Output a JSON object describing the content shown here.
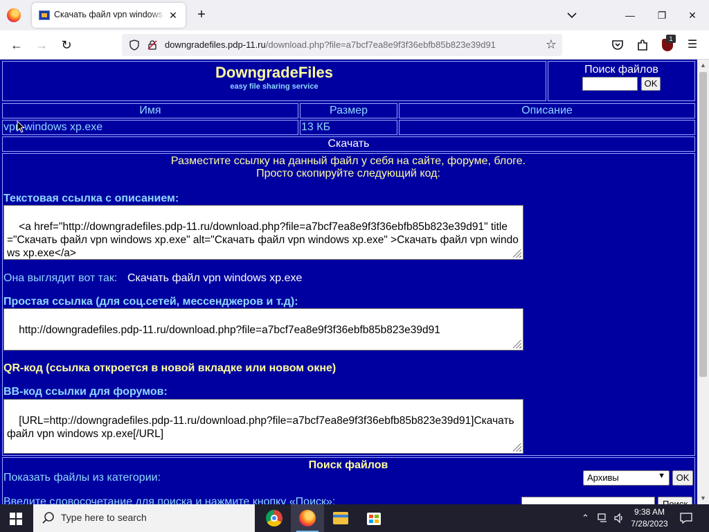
{
  "browser": {
    "tab_title": "Скачать файл vpn windows xp.exe",
    "url_host": "downgradefiles.pdp-11.ru",
    "url_path": "/download.php?file=a7bcf7ea8e9f3f36ebfb85b823e39d91",
    "extension_badge": "1",
    "icons": [
      "firefox-icon",
      "close-icon",
      "plus-icon",
      "chevron-down-icon",
      "back-icon",
      "forward-icon",
      "reload-icon",
      "shield-icon",
      "lock-icon",
      "star-icon",
      "pocket-icon",
      "extensions-icon",
      "ublock-icon",
      "menu-icon"
    ]
  },
  "page": {
    "site_title": "DowngradeFiles",
    "site_subtitle": "easy file sharing service",
    "search_title": "Поиск файлов",
    "search_ok": "OK",
    "table": {
      "headers": [
        "Имя",
        "Размер",
        "Описание"
      ],
      "row": {
        "name": "vpn windows xp.exe",
        "size": "13 КБ",
        "description": ""
      }
    },
    "download_label": "Скачать",
    "share_line1": "Разместите ссылку на данный файл у себя на сайте, форуме, блоге.",
    "share_line2": "Просто скопируйте следующий код:",
    "text_link_label": "Текстовая ссылка с описанием:",
    "text_link_code": "<a href=\"http://downgradefiles.pdp-11.ru/download.php?file=a7bcf7ea8e9f3f36ebfb85b823e39d91\" title=\"Скачать файл vpn windows xp.exe\" alt=\"Скачать файл vpn windows xp.exe\" >Скачать файл vpn windows xp.exe</a>",
    "preview_label": "Она выглядит вот так:",
    "preview_link": "Скачать файл vpn windows xp.exe",
    "simple_link_label": "Простая ссылка (для соц.сетей, мессенджеров и т.д):",
    "simple_link_code": "http://downgradefiles.pdp-11.ru/download.php?file=a7bcf7ea8e9f3f36ebfb85b823e39d91",
    "qr_label": "QR-код (ссылка откроется в новой вкладке или новом окне)",
    "bb_label": "BB-код ссылки для форумов:",
    "bb_code": "[URL=http://downgradefiles.pdp-11.ru/download.php?file=a7bcf7ea8e9f3f36ebfb85b823e39d91]Скачать файл vpn windows xp.exe[/URL]",
    "file_search_title": "Поиск файлов",
    "category_label": "Показать файлы из категории:",
    "category_selected": "Архивы",
    "category_ok": "OK",
    "keyword_label": "Введите словосочетание для поиска и нажмите кнопку «Поиск»:",
    "search_button": "Поиск"
  },
  "taskbar": {
    "search_placeholder": "Type here to search",
    "time": "9:38 AM",
    "date": "7/28/2023",
    "apps": [
      "chrome-icon",
      "firefox-icon",
      "file-explorer-icon",
      "store-icon"
    ]
  },
  "colors": {
    "page_bg": "#0000a0",
    "title_yellow": "#ffffa0",
    "text_cyan": "#8fd7ff",
    "cell_border": "#9aa8ff"
  }
}
